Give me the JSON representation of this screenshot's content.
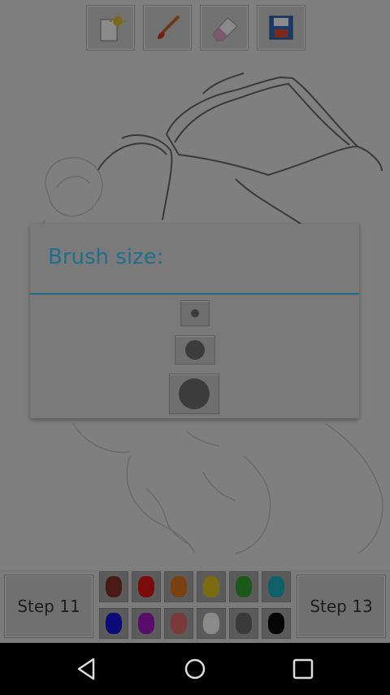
{
  "toolbar": {
    "tools": [
      {
        "name": "new-page",
        "icon": "new-page-icon"
      },
      {
        "name": "brush",
        "icon": "brush-icon"
      },
      {
        "name": "eraser",
        "icon": "eraser-icon"
      },
      {
        "name": "save",
        "icon": "save-icon"
      }
    ]
  },
  "dialog": {
    "title": "Brush size:",
    "accent_color": "#1e6c88",
    "sizes": [
      "small",
      "medium",
      "large"
    ]
  },
  "bottom": {
    "prev_label": "Step 11",
    "next_label": "Step 13",
    "palette": [
      "#4a1a14",
      "#7a0c0c",
      "#7a4010",
      "#7a6a10",
      "#1d5a1a",
      "#10606a",
      "#0b0b7a",
      "#5a0c6a",
      "#7a3a3a",
      "#8a8a8a",
      "#3a3a3a",
      "#050505"
    ]
  },
  "navbar": {
    "buttons": [
      "back-icon",
      "home-icon",
      "recents-icon"
    ]
  }
}
